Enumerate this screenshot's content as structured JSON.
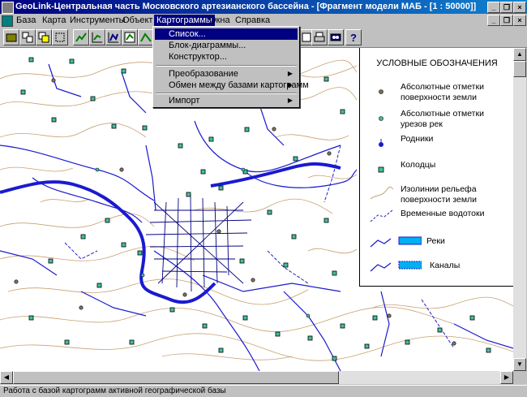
{
  "window": {
    "title": "GeoLink-Центральная часть Московского артезианского бассейна - [Фрагмент модели МАБ - [1 : 50000]]"
  },
  "menu": [
    {
      "label": "База"
    },
    {
      "label": "Карта"
    },
    {
      "label": "Инструменты"
    },
    {
      "label": "Объект"
    },
    {
      "label": "Картограммы"
    },
    {
      "label": "Окна"
    },
    {
      "label": "Справка"
    }
  ],
  "dropdown": {
    "items": [
      {
        "label": "Список..."
      },
      {
        "label": "Блок-диаграммы..."
      },
      {
        "label": "Конструктор..."
      },
      {
        "label": "Преобразование"
      },
      {
        "label": "Обмен между базами картограмм"
      },
      {
        "label": "Импорт"
      }
    ]
  },
  "legend": {
    "title": "УСЛОВНЫЕ ОБОЗНАЧЕНИЯ",
    "items": [
      {
        "l1": "Абсолютные   отметки",
        "l2": "поверхности      земли"
      },
      {
        "l1": "Абсолютные   отметки",
        "l2": "урезов   рек"
      },
      {
        "l1": "Родники",
        "l2": ""
      },
      {
        "l1": "Колодцы",
        "l2": ""
      },
      {
        "l1": "Изолинии    рельефа",
        "l2": "поверхности земли"
      },
      {
        "l1": "Временные водотоки",
        "l2": ""
      },
      {
        "l1": "Реки",
        "l2": ""
      },
      {
        "l1": "Каналы",
        "l2": ""
      }
    ]
  },
  "status": {
    "text": "Работа с базой картограмм активной географической базы"
  },
  "colors": {
    "title_bar": "#000080",
    "river": "#1a1ad0",
    "river_fill": "#00b0f0",
    "contour": "#c8a070",
    "well_fill": "#40c0a0",
    "elev_point": "#807060"
  }
}
